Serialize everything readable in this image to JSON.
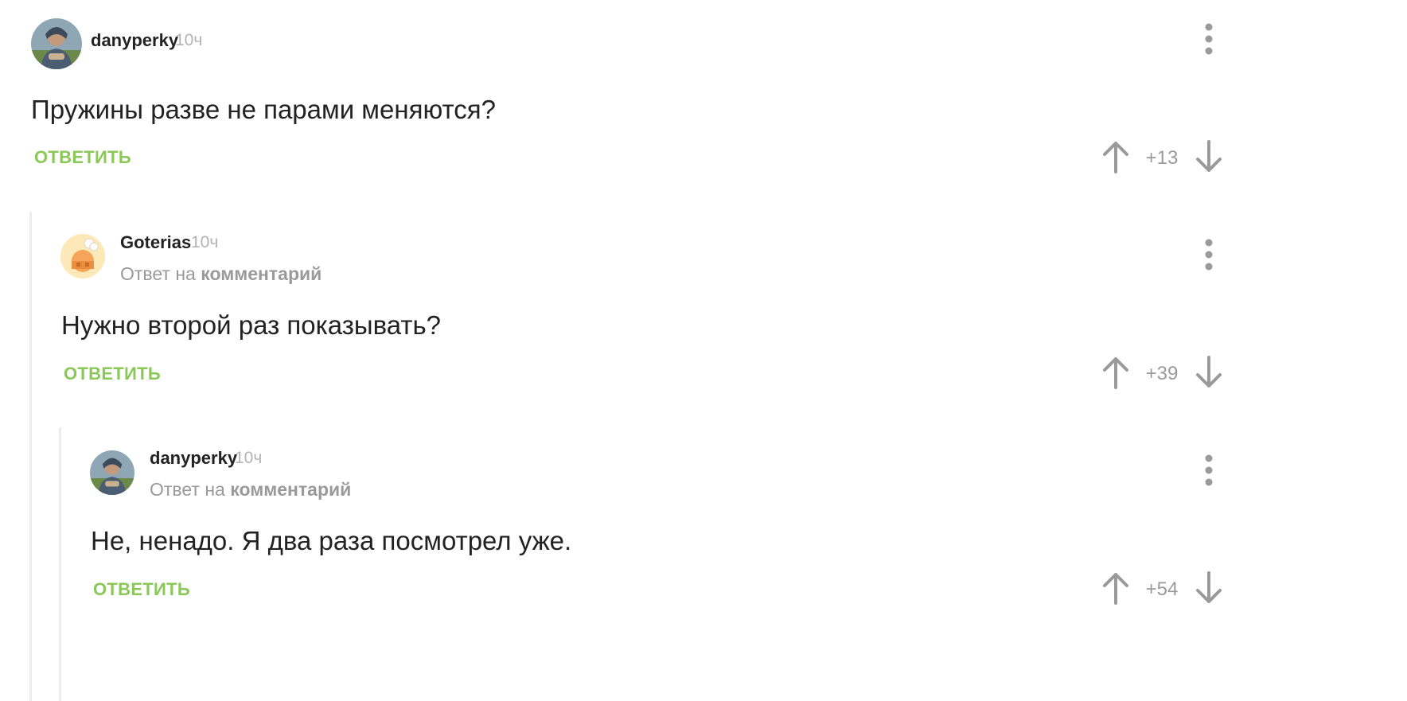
{
  "comments": [
    {
      "username": "danyperky",
      "time": "10ч",
      "text": "Пружины разве не парами меняются?",
      "reply_label": "ОТВЕТИТЬ",
      "score": "+13",
      "avatar": "user-photo"
    },
    {
      "username": "Goterias",
      "time": "10ч",
      "reply_prefix": "Ответ на",
      "reply_link": "комментарий",
      "text": "Нужно второй раз показывать?",
      "reply_label": "ОТВЕТИТЬ",
      "score": "+39",
      "avatar": "cartoon-orange"
    },
    {
      "username": "danyperky",
      "time": "10ч",
      "reply_prefix": "Ответ на",
      "reply_link": "комментарий",
      "text": "Не, ненадо. Я два раза посмотрел уже.",
      "reply_label": "ОТВЕТИТЬ",
      "score": "+54",
      "avatar": "user-photo"
    }
  ],
  "colors": {
    "accent_green": "#8ac858",
    "muted_gray": "#9a9a9a",
    "thread_line": "#ececec"
  },
  "icons": [
    "more-vertical-icon",
    "arrow-up-icon",
    "arrow-down-icon"
  ]
}
